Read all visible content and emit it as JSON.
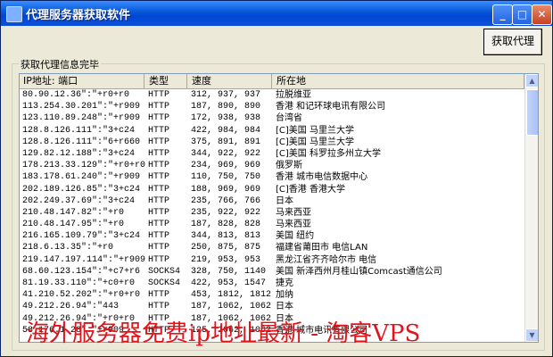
{
  "window": {
    "title": "代理服务器获取软件",
    "minimize_label": "_",
    "maximize_label": "□",
    "close_label": "✕"
  },
  "toolbar": {
    "fetch_label": "获取代理"
  },
  "group": {
    "label": "获取代理信息完毕"
  },
  "table": {
    "headers": [
      "IP地址: 端口",
      "类型",
      "速度",
      "所在地"
    ],
    "rows": [
      [
        "80.90.12.36\":\"+r0+r0",
        "HTTP",
        "312, 937, 937",
        "拉脱维亚"
      ],
      [
        "113.254.30.201\":\"+r909",
        "HTTP",
        "187, 890, 890",
        "香港 和记环球电讯有限公司"
      ],
      [
        "123.110.89.248\":\"+r909",
        "HTTP",
        "172, 938, 938",
        "台湾省"
      ],
      [
        "128.8.126.111\":\"3+c24",
        "HTTP",
        "422, 984, 984",
        "[C]美国 马里兰大学"
      ],
      [
        "128.8.126.111\":\"6+r660",
        "HTTP",
        "375, 891, 891",
        "[C]美国 马里兰大学"
      ],
      [
        "129.82.12.188\":\"3+c24",
        "HTTP",
        "344, 922, 922",
        "[C]美国 科罗拉多州立大学"
      ],
      [
        "178.213.33.129\":\"+r0+r0",
        "HTTP",
        "234, 969, 969",
        "俄罗斯"
      ],
      [
        "183.178.61.240\":\"+r909",
        "HTTP",
        "110, 750, 750",
        "香港 城市电信数据中心"
      ],
      [
        "202.189.126.85\":\"3+c24",
        "HTTP",
        "188, 969, 969",
        "[C]香港 香港大学"
      ],
      [
        "202.249.37.69\":\"3+c24",
        "HTTP",
        "235, 766, 766",
        "日本"
      ],
      [
        "210.48.147.82\":\"+r0",
        "HTTP",
        "235, 922, 922",
        "马来西亚"
      ],
      [
        "210.48.147.95\":\"+r0",
        "HTTP",
        "187, 828, 828",
        "马来西亚"
      ],
      [
        "216.165.109.79\":\"3+c24",
        "HTTP",
        "344, 813, 813",
        "美国 纽约"
      ],
      [
        "218.6.13.35\":\"+r0",
        "HTTP",
        "250, 875, 875",
        "福建省莆田市 电信LAN"
      ],
      [
        "219.147.197.114\":\"+r909",
        "HTTP",
        "219, 953, 953",
        "黑龙江省齐齐哈尔市 电信"
      ],
      [
        "68.60.123.154\":\"+c7+r6",
        "SOCKS4",
        "328, 750, 1140",
        "美国 新泽西州月桂山镇Comcast通信公司"
      ],
      [
        "81.19.33.110\":\"+c0+r0",
        "SOCKS4",
        "422, 953, 1547",
        "捷克"
      ],
      [
        "41.210.52.202\":\"+r0+r0",
        "HTTP",
        "453, 1812, 1812",
        "加纳"
      ],
      [
        "49.212.26.94\":\"443",
        "HTTP",
        "187, 1062, 1062",
        "日本"
      ],
      [
        "49.212.26.94\":\"+r0+r0",
        "HTTP",
        "187, 1062, 1062",
        "日本"
      ],
      [
        "58.176.1.28\":\"+r909",
        "HTTP",
        "125, 1062, 1062",
        "香港 城市电讯有限公司"
      ]
    ]
  },
  "scrollbar": {
    "up_icon": "▲",
    "down_icon": "▼"
  },
  "watermark": {
    "text": "海外服务器免费ip地址最新 - 淘客VPS"
  },
  "colors": {
    "titlebar": "#0a5cdb",
    "watermark": "#e0141b"
  }
}
